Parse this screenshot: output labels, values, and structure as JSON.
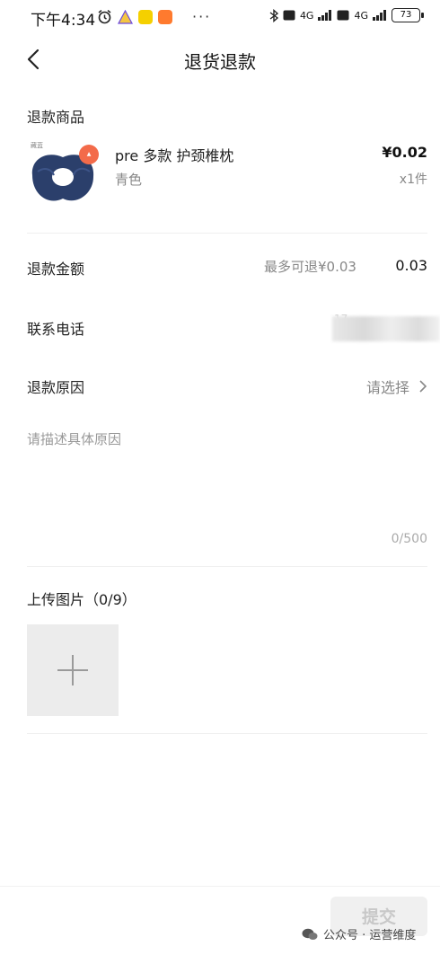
{
  "status_bar": {
    "time": "下午4:34",
    "icons_left": [
      "alarm-icon",
      "app-icon",
      "app-icon",
      "app-icon"
    ],
    "dots": "···",
    "network_1": "4G",
    "network_2": "4G",
    "battery": "73"
  },
  "nav": {
    "title": "退货退款",
    "back_icon": "chevron-left-icon"
  },
  "product_section": {
    "title": "退款商品",
    "product": {
      "name": "pre 多款 护颈椎枕",
      "variant": "青色",
      "price": "¥0.02",
      "quantity": "x1件"
    }
  },
  "refund_amount": {
    "label": "退款金额",
    "max_text": "最多可退¥0.03",
    "value": "0.03"
  },
  "contact_phone": {
    "label": "联系电话",
    "value": "17"
  },
  "refund_reason": {
    "label": "退款原因",
    "placeholder": "请选择"
  },
  "description": {
    "placeholder": "请描述具体原因",
    "counter": "0/500"
  },
  "upload": {
    "title": "上传图片（0/9）"
  },
  "submit": {
    "label": "提交"
  },
  "watermark": {
    "text": "公众号 · 运营维度"
  },
  "colors": {
    "badge": "#f36b4a",
    "pillow": "#2b3f6b",
    "upload_bg": "#ececec"
  }
}
